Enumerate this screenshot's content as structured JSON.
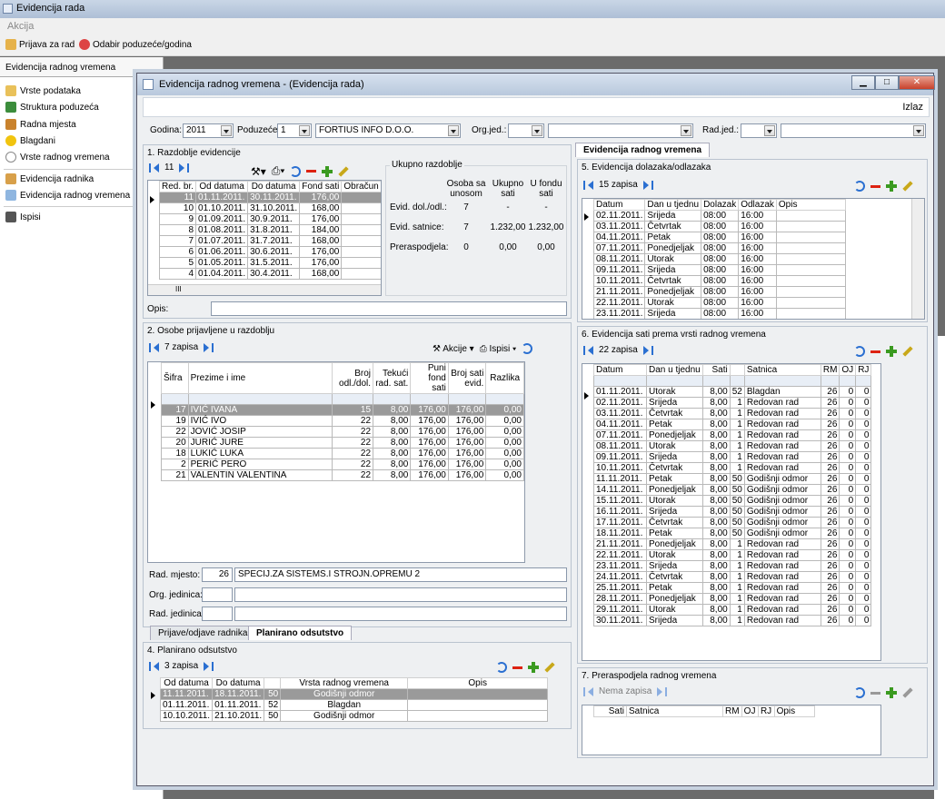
{
  "app": {
    "title": "Evidencija rada",
    "menu": "Akcija"
  },
  "toolbar": {
    "prijava": "Prijava za rad",
    "odabir": "Odabir poduzeće/godina"
  },
  "nav": {
    "header": "Evidencija radnog vremena",
    "items": [
      "Vrste podataka",
      "Struktura poduzeća",
      "Radna mjesta",
      "Blagdani",
      "Vrste radnog vremena",
      "Evidencija radnika",
      "Evidencija radnog vremena",
      "Ispisi"
    ]
  },
  "child": {
    "title": "Evidencija radnog vremena - (Evidencija rada)",
    "izlaz": "Izlaz"
  },
  "filter": {
    "godina_label": "Godina:",
    "godina": "2011",
    "poduzece_label": "Poduzeće:",
    "poduzece_id": "1",
    "poduzece_name": "FORTIUS INFO D.O.O.",
    "org_label": "Org.jed.:",
    "rad_label": "Rad.jed.:"
  },
  "p1": {
    "title": "1. Razdoblje evidencije",
    "count": "11",
    "cols": [
      "Red. br.",
      "Od datuma",
      "Do datuma",
      "Fond sati",
      "Obračun"
    ],
    "rows": [
      [
        "11",
        "01.11.2011.",
        "30.11.2011.",
        "176,00"
      ],
      [
        "10",
        "01.10.2011.",
        "31.10.2011.",
        "168,00"
      ],
      [
        "9",
        "01.09.2011.",
        "30.9.2011.",
        "176,00"
      ],
      [
        "8",
        "01.08.2011.",
        "31.8.2011.",
        "184,00"
      ],
      [
        "7",
        "01.07.2011.",
        "31.7.2011.",
        "168,00"
      ],
      [
        "6",
        "01.06.2011.",
        "30.6.2011.",
        "176,00"
      ],
      [
        "5",
        "01.05.2011.",
        "31.5.2011.",
        "176,00"
      ],
      [
        "4",
        "01.04.2011.",
        "30.4.2011.",
        "168,00"
      ]
    ],
    "ukupno_title": "Ukupno razdoblje",
    "uk_cols": [
      "Osoba sa unosom",
      "Ukupno sati",
      "U fondu sati"
    ],
    "uk_rows": [
      [
        "Evid. dol./odl.:",
        "7",
        "-",
        "-"
      ],
      [
        "Evid. satnice:",
        "7",
        "1.232,00",
        "1.232,00"
      ],
      [
        "Preraspodjela:",
        "0",
        "0,00",
        "0,00"
      ]
    ],
    "opis_label": "Opis:",
    "scroll_mark": "III"
  },
  "p2": {
    "title": "2. Osobe prijavljene u razdoblju",
    "count": "7 zapisa",
    "akcije": "Akcije",
    "ispisi": "Ispisi",
    "cols": [
      "Šifra",
      "Prezime i ime",
      "Broj odl./dol.",
      "Tekući rad. sat.",
      "Puni fond sati",
      "Broj sati evid.",
      "Razlika"
    ],
    "rows": [
      [
        "17",
        "IVIĆ IVANA",
        "15",
        "8,00",
        "176,00",
        "176,00",
        "0,00"
      ],
      [
        "19",
        "IVIĆ IVO",
        "22",
        "8,00",
        "176,00",
        "176,00",
        "0,00"
      ],
      [
        "22",
        "JOVIĆ JOSIP",
        "22",
        "8,00",
        "176,00",
        "176,00",
        "0,00"
      ],
      [
        "20",
        "JURIĆ JURE",
        "22",
        "8,00",
        "176,00",
        "176,00",
        "0,00"
      ],
      [
        "18",
        "LUKIĆ LUKA",
        "22",
        "8,00",
        "176,00",
        "176,00",
        "0,00"
      ],
      [
        "2",
        "PERIĆ PERO",
        "22",
        "8,00",
        "176,00",
        "176,00",
        "0,00"
      ],
      [
        "21",
        "VALENTIN VALENTINA",
        "22",
        "8,00",
        "176,00",
        "176,00",
        "0,00"
      ]
    ],
    "rad_mjesto_label": "Rad. mjesto:",
    "rad_mjesto_id": "26",
    "rad_mjesto": "SPECIJ.ZA SISTEMS.I STROJN.OPREMU 2",
    "org_label": "Org. jedinica:",
    "radj_label": "Rad. jedinica:",
    "tabs": [
      "Prijave/odjave radnika",
      "Planirano odsutstvo"
    ]
  },
  "p4": {
    "title": "4. Planirano odsutstvo",
    "count": "3 zapisa",
    "cols": [
      "Od datuma",
      "Do datuma",
      "",
      "Vrsta radnog vremena",
      "Opis"
    ],
    "rows": [
      [
        "11.11.2011.",
        "18.11.2011.",
        "50",
        "Godišnji odmor",
        ""
      ],
      [
        "01.11.2011.",
        "01.11.2011.",
        "52",
        "Blagdan",
        ""
      ],
      [
        "10.10.2011.",
        "21.10.2011.",
        "50",
        "Godišnji odmor",
        ""
      ]
    ]
  },
  "right": {
    "tab": "Evidencija radnog vremena"
  },
  "p5": {
    "title": "5. Evidencija dolazaka/odlazaka",
    "count": "15 zapisa",
    "cols": [
      "Datum",
      "Dan u tjednu",
      "Dolazak",
      "Odlazak",
      "Opis"
    ],
    "rows": [
      [
        "02.11.2011.",
        "Srijeda",
        "08:00",
        "16:00"
      ],
      [
        "03.11.2011.",
        "Četvrtak",
        "08:00",
        "16:00"
      ],
      [
        "04.11.2011.",
        "Petak",
        "08:00",
        "16:00"
      ],
      [
        "07.11.2011.",
        "Ponedjeljak",
        "08:00",
        "16:00"
      ],
      [
        "08.11.2011.",
        "Utorak",
        "08:00",
        "16:00"
      ],
      [
        "09.11.2011.",
        "Srijeda",
        "08:00",
        "16:00"
      ],
      [
        "10.11.2011.",
        "Četvrtak",
        "08:00",
        "16:00"
      ],
      [
        "21.11.2011.",
        "Ponedjeljak",
        "08:00",
        "16:00"
      ],
      [
        "22.11.2011.",
        "Utorak",
        "08:00",
        "16:00"
      ],
      [
        "23.11.2011.",
        "Srijeda",
        "08:00",
        "16:00"
      ]
    ]
  },
  "p6": {
    "title": "6. Evidencija sati prema vrsti radnog vremena",
    "count": "22 zapisa",
    "cols": [
      "Datum",
      "Dan u tjednu",
      "Sati",
      "Satnica",
      "RM",
      "OJ",
      "RJ"
    ],
    "rows": [
      [
        "01.11.2011.",
        "Utorak",
        "8,00",
        "52",
        "Blagdan",
        "26",
        "0",
        "0"
      ],
      [
        "02.11.2011.",
        "Srijeda",
        "8,00",
        "1",
        "Redovan rad",
        "26",
        "0",
        "0"
      ],
      [
        "03.11.2011.",
        "Četvrtak",
        "8,00",
        "1",
        "Redovan rad",
        "26",
        "0",
        "0"
      ],
      [
        "04.11.2011.",
        "Petak",
        "8,00",
        "1",
        "Redovan rad",
        "26",
        "0",
        "0"
      ],
      [
        "07.11.2011.",
        "Ponedjeljak",
        "8,00",
        "1",
        "Redovan rad",
        "26",
        "0",
        "0"
      ],
      [
        "08.11.2011.",
        "Utorak",
        "8,00",
        "1",
        "Redovan rad",
        "26",
        "0",
        "0"
      ],
      [
        "09.11.2011.",
        "Srijeda",
        "8,00",
        "1",
        "Redovan rad",
        "26",
        "0",
        "0"
      ],
      [
        "10.11.2011.",
        "Četvrtak",
        "8,00",
        "1",
        "Redovan rad",
        "26",
        "0",
        "0"
      ],
      [
        "11.11.2011.",
        "Petak",
        "8,00",
        "50",
        "Godišnji odmor",
        "26",
        "0",
        "0"
      ],
      [
        "14.11.2011.",
        "Ponedjeljak",
        "8,00",
        "50",
        "Godišnji odmor",
        "26",
        "0",
        "0"
      ],
      [
        "15.11.2011.",
        "Utorak",
        "8,00",
        "50",
        "Godišnji odmor",
        "26",
        "0",
        "0"
      ],
      [
        "16.11.2011.",
        "Srijeda",
        "8,00",
        "50",
        "Godišnji odmor",
        "26",
        "0",
        "0"
      ],
      [
        "17.11.2011.",
        "Četvrtak",
        "8,00",
        "50",
        "Godišnji odmor",
        "26",
        "0",
        "0"
      ],
      [
        "18.11.2011.",
        "Petak",
        "8,00",
        "50",
        "Godišnji odmor",
        "26",
        "0",
        "0"
      ],
      [
        "21.11.2011.",
        "Ponedjeljak",
        "8,00",
        "1",
        "Redovan rad",
        "26",
        "0",
        "0"
      ],
      [
        "22.11.2011.",
        "Utorak",
        "8,00",
        "1",
        "Redovan rad",
        "26",
        "0",
        "0"
      ],
      [
        "23.11.2011.",
        "Srijeda",
        "8,00",
        "1",
        "Redovan rad",
        "26",
        "0",
        "0"
      ],
      [
        "24.11.2011.",
        "Četvrtak",
        "8,00",
        "1",
        "Redovan rad",
        "26",
        "0",
        "0"
      ],
      [
        "25.11.2011.",
        "Petak",
        "8,00",
        "1",
        "Redovan rad",
        "26",
        "0",
        "0"
      ],
      [
        "28.11.2011.",
        "Ponedjeljak",
        "8,00",
        "1",
        "Redovan rad",
        "26",
        "0",
        "0"
      ],
      [
        "29.11.2011.",
        "Utorak",
        "8,00",
        "1",
        "Redovan rad",
        "26",
        "0",
        "0"
      ],
      [
        "30.11.2011.",
        "Srijeda",
        "8,00",
        "1",
        "Redovan rad",
        "26",
        "0",
        "0"
      ]
    ]
  },
  "p7": {
    "title": "7. Preraspodjela radnog vremena",
    "count": "Nema zapisa",
    "cols": [
      "Sati",
      "Satnica",
      "RM",
      "OJ",
      "RJ",
      "Opis"
    ]
  }
}
